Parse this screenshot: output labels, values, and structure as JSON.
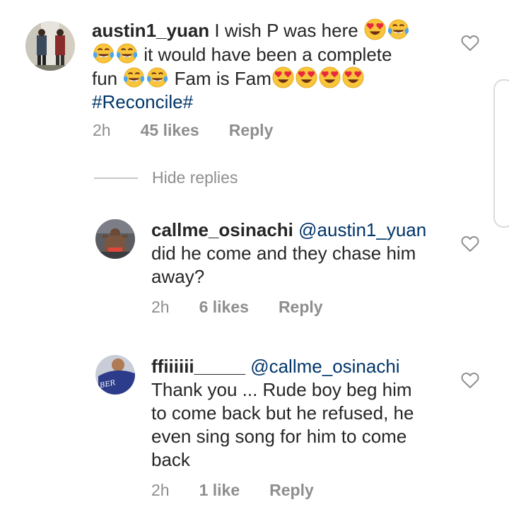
{
  "comments": [
    {
      "username": "austin1_yuan",
      "avatar": "person-avatar",
      "text_parts": {
        "a": "I wish P was here",
        "b": "it would have been a complete",
        "c": "fun",
        "d": "Fam is Fam",
        "hashtag": "#Reconcile#"
      },
      "time": "2h",
      "likes": "45 likes",
      "reply": "Reply"
    },
    {
      "username": "callme_osinachi",
      "mention": "@austin1_yuan",
      "lines": [
        "did he come and they chase him",
        "away?"
      ],
      "time": "2h",
      "likes": "6 likes",
      "reply": "Reply"
    },
    {
      "username": "ffiiiiii_____",
      "mention": "@callme_osinachi",
      "lines": [
        "Thank you ... Rude boy beg him",
        "to come back but he refused, he",
        "even sing song for him to come",
        "back"
      ],
      "time": "2h",
      "likes": "1 like",
      "reply": "Reply"
    }
  ],
  "hide_replies": "Hide replies",
  "icons": {
    "like": "heart-outline-icon",
    "heart_eyes": "heart-eyes-emoji",
    "tears_of_joy": "tears-of-joy-emoji"
  },
  "colors": {
    "text": "#262626",
    "meta": "#8e8e8e",
    "link": "#003569",
    "emoji_face": "#f7c13a"
  }
}
